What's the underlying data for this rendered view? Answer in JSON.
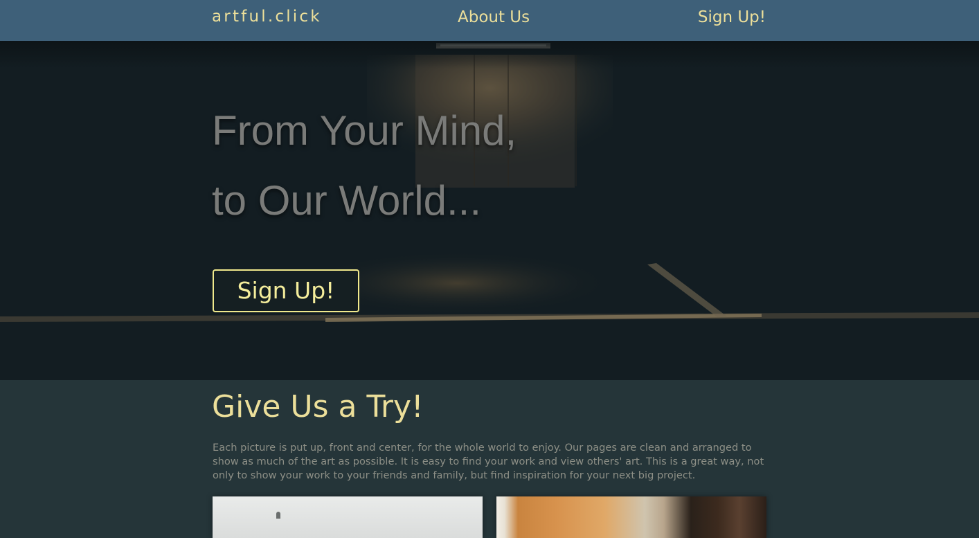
{
  "nav": {
    "brand": "artful.click",
    "about": "About Us",
    "signup": "Sign Up!"
  },
  "hero": {
    "line1": "From Your Mind,",
    "line2": "to Our World...",
    "cta": "Sign Up!"
  },
  "section": {
    "title": "Give Us a Try!",
    "body": "Each picture is put up, front and center, for the whole world to enjoy. Our pages are clean and arranged to show as much of the art as possible. It is easy to find your work and view others' art. This is a great way, not only to show your work to your friends and family, but find inspiration for your next big project."
  },
  "colors": {
    "navbar": "#3e6079",
    "accent_text": "#ecdf9a",
    "hero_button_border": "#f0e98c",
    "hero_background": "#131d22",
    "section_background": "#253539"
  }
}
